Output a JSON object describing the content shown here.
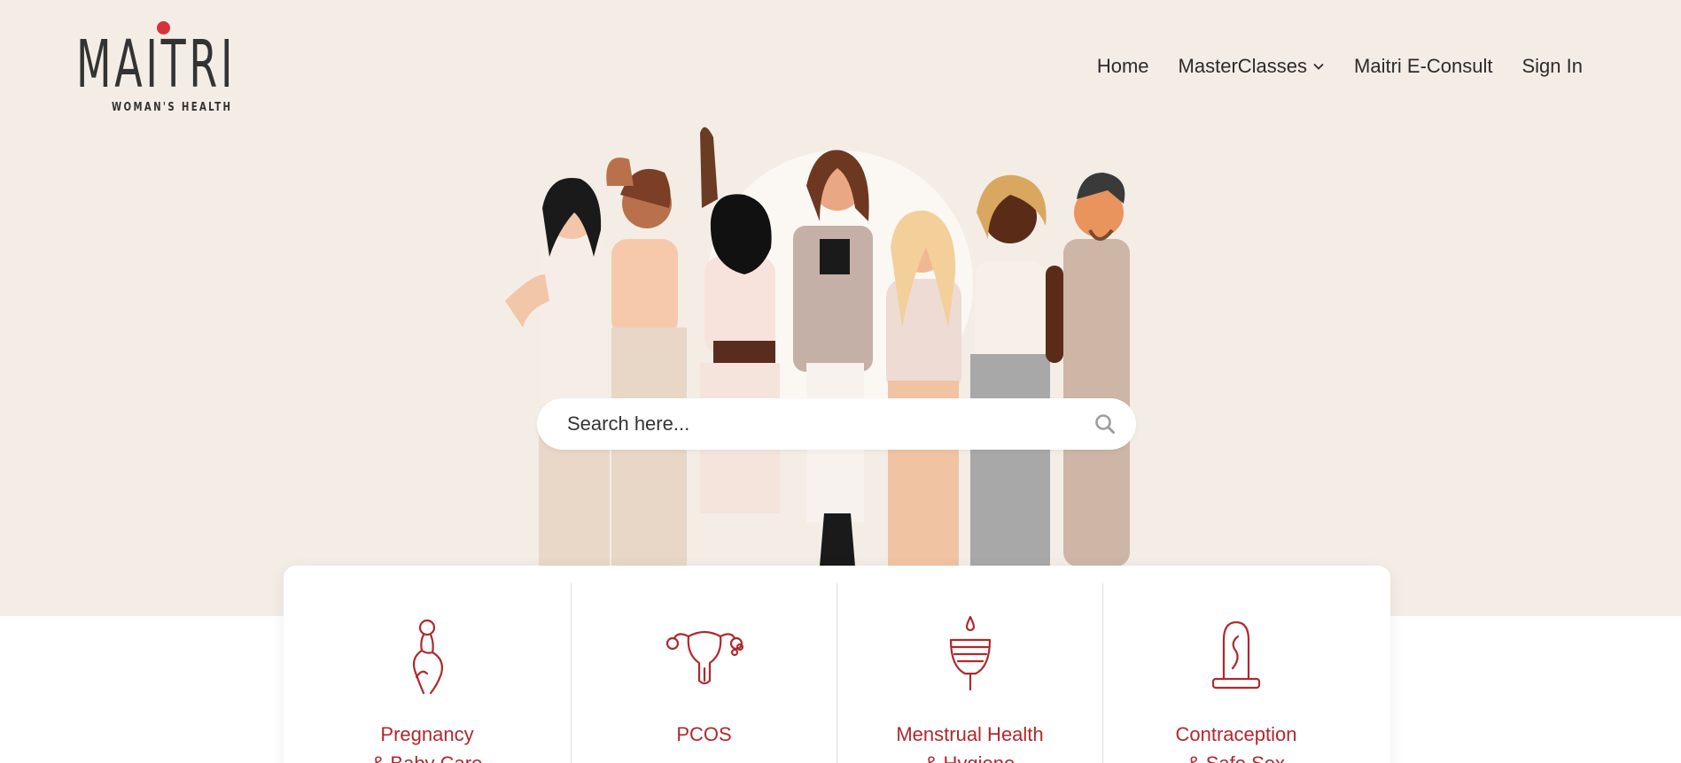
{
  "brand": {
    "name": "MAITRI",
    "tagline": "WOMAN'S HEALTH",
    "accent": "#d8313a"
  },
  "nav": {
    "items": [
      {
        "label": "Home"
      },
      {
        "label": "MasterClasses",
        "icon": "chevron-down-icon"
      },
      {
        "label": "Maitri E-Consult"
      },
      {
        "label": "Sign In"
      }
    ]
  },
  "search": {
    "placeholder": "Search here...",
    "icon": "search-icon"
  },
  "categories": [
    {
      "label": "Pregnancy\n& Baby Care",
      "icon": "pregnant-woman-icon"
    },
    {
      "label": "PCOS",
      "icon": "uterus-icon"
    },
    {
      "label": "Menstrual Health\n& Hygiene",
      "icon": "menstrual-cup-icon"
    },
    {
      "label": "Contraception\n& Safe Sex",
      "icon": "condom-icon"
    }
  ],
  "colors": {
    "hero_bg": "#f3ede6",
    "category_text": "#b0282e"
  }
}
